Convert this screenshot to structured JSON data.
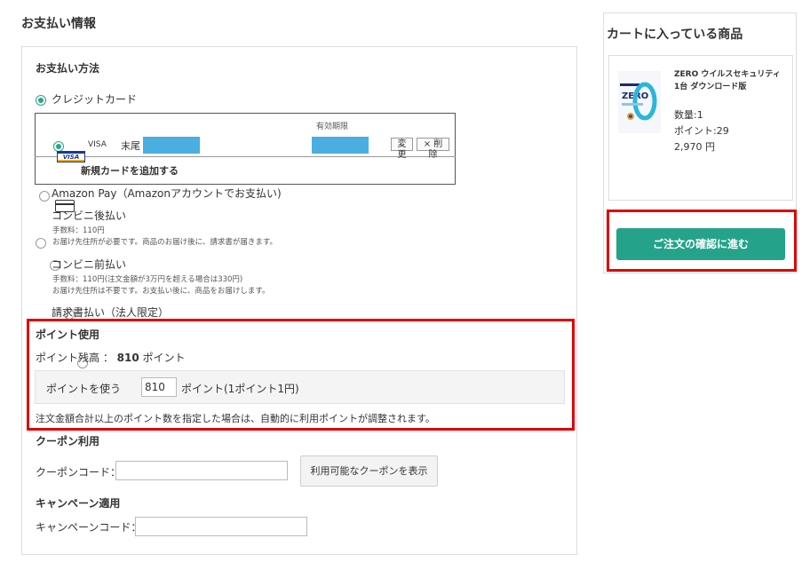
{
  "page_title": "お支払い情報",
  "payment": {
    "section_title": "お支払い方法",
    "credit_card": {
      "label": "クレジットカード",
      "selected": true
    },
    "card_table": {
      "expiry_header": "有効期限",
      "saved_card": {
        "brand_logo_text": "VISA",
        "brand": "VISA",
        "last_digits_label": "末尾",
        "change_label": "変更",
        "delete_label": "× 削除"
      },
      "add_new_card_label": "新規カードを追加する"
    },
    "amazon_pay": {
      "label": "Amazon Pay（Amazonアカウントでお支払い)"
    },
    "cvs_postpay": {
      "label": "コンビニ後払い",
      "note1": "手数料：110円",
      "note2": "お届け先住所が必要です。商品のお届け後に、請求書が届きます。"
    },
    "cvs_prepay": {
      "label": "コンビニ前払い",
      "note1": "手数料：110円(注文金額が3万円を超える場合は330円)",
      "note2": "お届け先住所は不要です。お支払い後に、商品をお届けします。"
    },
    "invoice": {
      "label": "請求書払い（法人限定）"
    }
  },
  "points": {
    "section_title": "ポイント使用",
    "balance_label": "ポイント残高 ：",
    "balance_value": "810",
    "balance_unit": "ポイント",
    "use_label": "ポイントを使う",
    "use_value": "810",
    "use_unit": "ポイント(1ポイント1円)",
    "note": "注文金額合計以上のポイント数を指定した場合は、自動的に利用ポイントが調整されます。"
  },
  "coupon": {
    "section_title": "クーポン利用",
    "code_label": "クーポンコード：",
    "code_value": "",
    "show_button": "利用可能なクーポンを表示"
  },
  "campaign": {
    "section_title": "キャンペーン適用",
    "code_label": "キャンペーンコード：",
    "code_value": ""
  },
  "cart": {
    "title": "カートに入っている商品",
    "product": {
      "name": "ZERO ウイルスセキュリティ 1台 ダウンロード版",
      "quantity": "数量:1",
      "points": "ポイント:29",
      "price": "2,970 円",
      "image_text": "ZERO"
    },
    "confirm_button": "ご注文の確認に進む"
  },
  "colors": {
    "accent": "#24a38a",
    "highlight": "#e00000",
    "masked": "#4aaee0"
  }
}
